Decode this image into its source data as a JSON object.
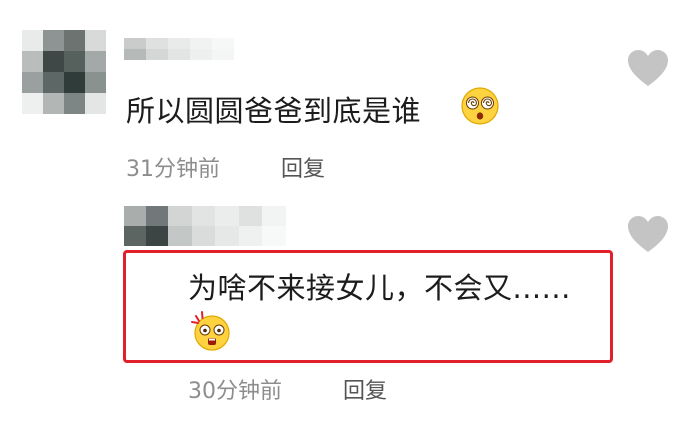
{
  "comments": [
    {
      "text": "所以圆圆爸爸到底是谁",
      "emoji": "dizzy-face-emoji",
      "time": "31分钟前",
      "reply_label": "回复"
    },
    {
      "text": "为啥不来接女儿，不会又......",
      "emoji": "shocked-face-emoji",
      "time": "30分钟前",
      "reply_label": "回复",
      "highlighted": true,
      "highlight_color": "#e0212b"
    }
  ],
  "icons": {
    "like": "heart-icon"
  }
}
